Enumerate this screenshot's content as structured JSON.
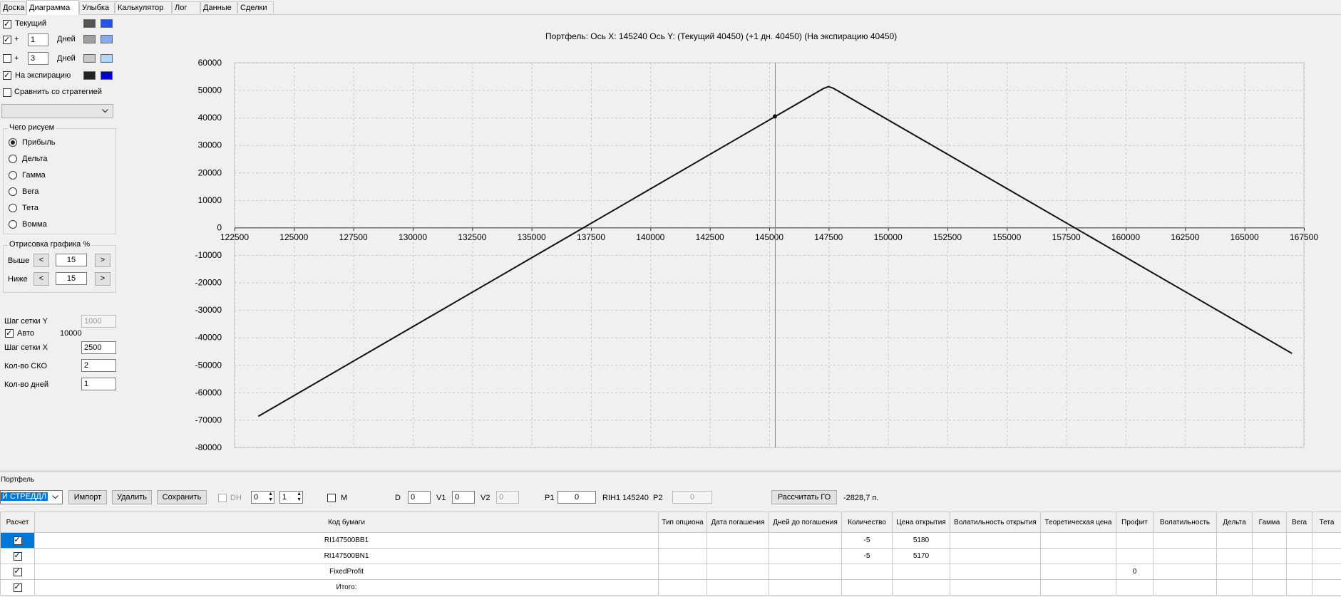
{
  "tabs": [
    "Доска",
    "Диаграмма",
    "Улыбка",
    "Калькулятор",
    "Лог",
    "Данные",
    "Сделки"
  ],
  "active_tab": "Диаграмма",
  "left": {
    "current_label": "Текущий",
    "plus": "+",
    "days_label": "Дней",
    "days1": "1",
    "days2": "3",
    "expiry_label": "На экспирацию",
    "compare_label": "Сравнить со стратегией",
    "what_title": "Чего рисуем",
    "radios": [
      "Прибыль",
      "Дельта",
      "Гамма",
      "Вега",
      "Тета",
      "Вомма"
    ],
    "render_title": "Отрисовка графика %",
    "above_label": "Выше",
    "below_label": "Ниже",
    "above_value": "15",
    "below_value": "15",
    "dec_btn": "<",
    "inc_btn": ">",
    "grid_y_label": "Шаг сетки Y",
    "grid_y_value": "1000",
    "auto_label": "Авто",
    "auto_value": "10000",
    "grid_x_label": "Шаг сетки X",
    "grid_x_value": "2500",
    "sko_label": "Кол-во СКО",
    "sko_value": "2",
    "days_count_label": "Кол-во дней",
    "days_count_value": "1",
    "swatch_colors": {
      "current": [
        "#555555",
        "#2255ee"
      ],
      "plus1": [
        "#a0a0a0",
        "#88aaf0"
      ],
      "plus3": [
        "#c8c8c8",
        "#b0d8ff"
      ],
      "expiry": [
        "#222222",
        "#0000cc"
      ]
    }
  },
  "chart_header": "Портфель: Ось X: 145240 Ось Y:  (Текущий 40450)  (+1 дн. 40450)  (На экспирацию 40450)",
  "chart_data": {
    "type": "line",
    "x_ticks": [
      122500,
      125000,
      127500,
      130000,
      132500,
      135000,
      137500,
      140000,
      142500,
      145000,
      147500,
      150000,
      152500,
      155000,
      157500,
      160000,
      162500,
      165000,
      167500
    ],
    "y_ticks": [
      60000,
      50000,
      40000,
      30000,
      20000,
      10000,
      0,
      -10000,
      -20000,
      -30000,
      -40000,
      -50000,
      -60000,
      -70000,
      -80000
    ],
    "xlim": [
      122500,
      167500
    ],
    "ylim": [
      -80000,
      60000
    ],
    "grid": true,
    "series": [
      {
        "color": "#111111",
        "x": [
          123500,
          147300,
          147500,
          147700,
          167000
        ],
        "y": [
          -68700,
          50700,
          51300,
          50700,
          -45800
        ]
      }
    ],
    "marker": {
      "x": 145240,
      "y": 40450
    },
    "cursor_x": 145240
  },
  "bottom": {
    "portfolio_label": "Портфель",
    "strategy_value": "Й СТРЕДДЛ",
    "import_btn": "Импорт",
    "delete_btn": "Удалить",
    "save_btn": "Сохранить",
    "dh_label": "DH",
    "spin1": "0",
    "spin2": "1",
    "m_label": "M",
    "d_label": "D",
    "d_value": "0",
    "v1_label": "V1",
    "v1_value": "0",
    "v2_label": "V2",
    "v2_value": "0",
    "p1_label": "P1",
    "p1_value": "0",
    "instrument_text": "RIH1 145240",
    "p2_label": "P2",
    "p2_value": "0",
    "calc_btn": "Рассчитать ГО",
    "go_value": "-2828,7 п."
  },
  "table": {
    "headers": [
      "Расчет",
      "Код бумаги",
      "Тип опциона",
      "Дата погашения",
      "Дней до погашения",
      "Количество",
      "Цена открытия",
      "Волатильность открытия",
      "Теоретическая цена",
      "Профит",
      "Волатильность",
      "Дельта",
      "Гамма",
      "Вега",
      "Тета"
    ],
    "rows": [
      {
        "code": "RI147500BB1",
        "qty": "-5",
        "price": "5180",
        "profit": ""
      },
      {
        "code": "RI147500BN1",
        "qty": "-5",
        "price": "5170",
        "profit": ""
      },
      {
        "code": "FixedProfit",
        "qty": "",
        "price": "",
        "profit": "0"
      },
      {
        "code": "Итого:",
        "qty": "",
        "price": "",
        "profit": ""
      }
    ]
  }
}
